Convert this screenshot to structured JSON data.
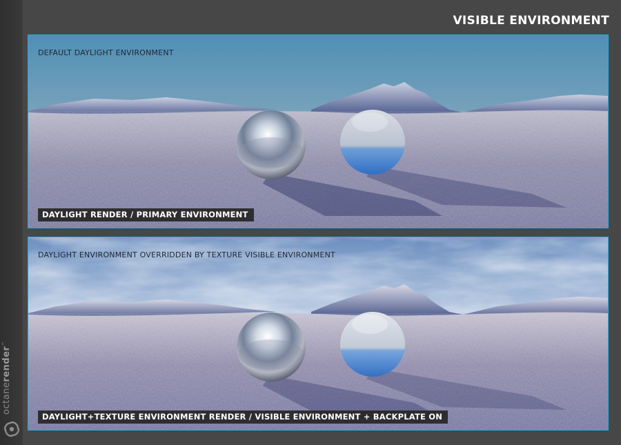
{
  "page": {
    "title": "VISIBLE ENVIRONMENT"
  },
  "brand": {
    "name_light": "octane",
    "name_bold": "render",
    "trademark": "™",
    "logo_icon": "octane-logo-icon"
  },
  "panels": [
    {
      "heading": "DEFAULT DAYLIGHT ENVIRONMENT",
      "caption": "DAYLIGHT RENDER / PRIMARY ENVIRONMENT",
      "sky": "clear-gradient"
    },
    {
      "heading": "DAYLIGHT ENVIRONMENT OVERRIDDEN BY TEXTURE VISIBLE ENVIRONMENT",
      "caption": "DAYLIGHT+TEXTURE ENVIRONMENT RENDER / VISIBLE ENVIRONMENT + BACKPLATE ON",
      "sky": "cloudy-texture"
    }
  ],
  "colors": {
    "background": "#474747",
    "sidebar": "#333333",
    "panel_border": "#2ea8e0",
    "caption_bg": "#262626",
    "title_text": "#ffffff"
  }
}
